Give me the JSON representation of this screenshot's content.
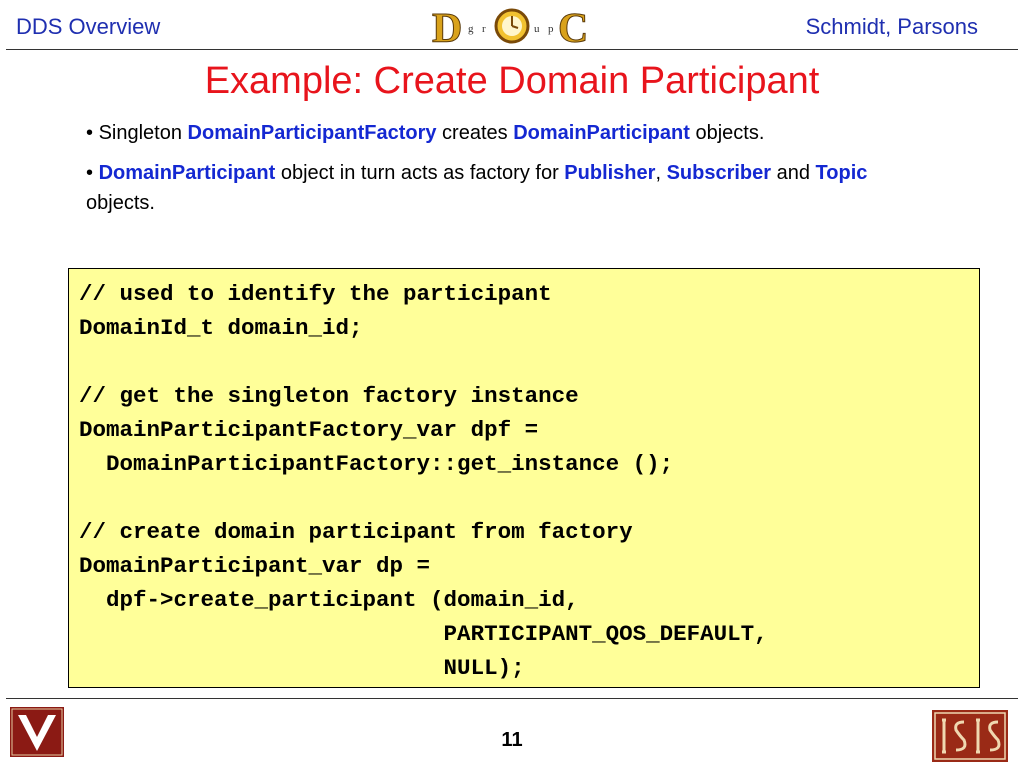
{
  "header": {
    "left": "DDS Overview",
    "right": "Schmidt, Parsons",
    "logo": {
      "letters": [
        "D",
        "g",
        "r",
        "O",
        "u",
        "p",
        "C"
      ],
      "icon": "doc-group-logo"
    }
  },
  "title": "Example: Create Domain Participant",
  "bullets": [
    {
      "marker": "•",
      "parts": [
        "Singleton ",
        "DomainParticipantFactory",
        " creates ",
        "DomainParticipant",
        " objects."
      ]
    },
    {
      "marker": "•",
      "parts": [
        "DomainParticipant",
        " object in turn acts as factory for ",
        "Publisher",
        ", ",
        "Subscriber",
        " and ",
        "Topic",
        " objects."
      ]
    }
  ],
  "code": "// used to identify the participant\nDomainId_t domain_id;\n\n// get the singleton factory instance\nDomainParticipantFactory_var dpf =\n  DomainParticipantFactory::get_instance ();\n\n// create domain participant from factory\nDomainParticipant_var dp =\n  dpf->create_participant (domain_id,\n                           PARTICIPANT_QOS_DEFAULT,\n                           NULL);",
  "footer": {
    "page_number": "11",
    "left_logo": "vanderbilt-logo",
    "right_logo": "isis-logo"
  },
  "colors": {
    "header_text": "#1f2fb0",
    "title": "#e8141c",
    "keyword": "#1428d2",
    "code_background": "#ffff99"
  }
}
